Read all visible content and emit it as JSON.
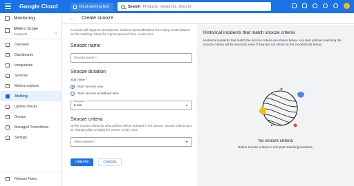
{
  "topbar": {
    "brand": "Google Cloud",
    "project": "cloud-alerting-test",
    "search_label": "Search",
    "search_placeholder": "Products, resources, docs (/)"
  },
  "sidenav": {
    "title": "Monitoring",
    "scope_title": "Metrics Scope",
    "scope_sub": "3 projects",
    "items": [
      {
        "label": "Overview",
        "icon": "overview-icon"
      },
      {
        "label": "Dashboards",
        "icon": "dashboard-icon"
      },
      {
        "label": "Integrations",
        "icon": "integrations-icon"
      },
      {
        "label": "Services",
        "icon": "services-icon"
      },
      {
        "label": "Metrics explorer",
        "icon": "chart-icon"
      },
      {
        "label": "Alerting",
        "icon": "bell-icon",
        "active": true
      },
      {
        "label": "Uptime checks",
        "icon": "uptime-icon"
      },
      {
        "label": "Groups",
        "icon": "groups-icon"
      },
      {
        "label": "Managed Prometheus",
        "icon": "prometheus-icon"
      },
      {
        "label": "Settings",
        "icon": "gear-icon"
      }
    ],
    "footer": "Release Notes"
  },
  "header": {
    "title": "Create snooze"
  },
  "form": {
    "intro": "A snooze will suppress downstream incidents and notifications from being created based on the matching criteria for a given period of time.",
    "intro_link": "Learn more",
    "name_section": "Snooze name",
    "name_placeholder": "Snooze name *",
    "duration_section": "Snooze duration",
    "start_time_label": "Start time *",
    "radio_now": "Start snooze now",
    "radio_defined": "Start snooze at defined time",
    "duration_label": "Duration *",
    "duration_value": "5 min",
    "criteria_section": "Snooze criteria",
    "criteria_help": "Define snooze criteria for what policies will be included in the snooze. Snooze criteria can't be changed after creating the snooze.",
    "criteria_link": "Learn more",
    "policies_placeholder": "Alert policies *",
    "create_label": "CREATE",
    "cancel_label": "CANCEL"
  },
  "panel": {
    "title": "Historical incidents that match snooze criteria",
    "desc": "Historical incidents that match the snooze criteria are shown below. Any alert policies matching the snooze criteria will be snoozed, even if they are not shown in the incidents list below.",
    "empty_title": "No snooze criteria",
    "empty_desc": "Define snooze criteria to see past matching incidents."
  },
  "colors": {
    "brand_blue": "#1a73e8",
    "active_bg": "#e8f0fe",
    "panel_bg": "#f1f3f4"
  }
}
